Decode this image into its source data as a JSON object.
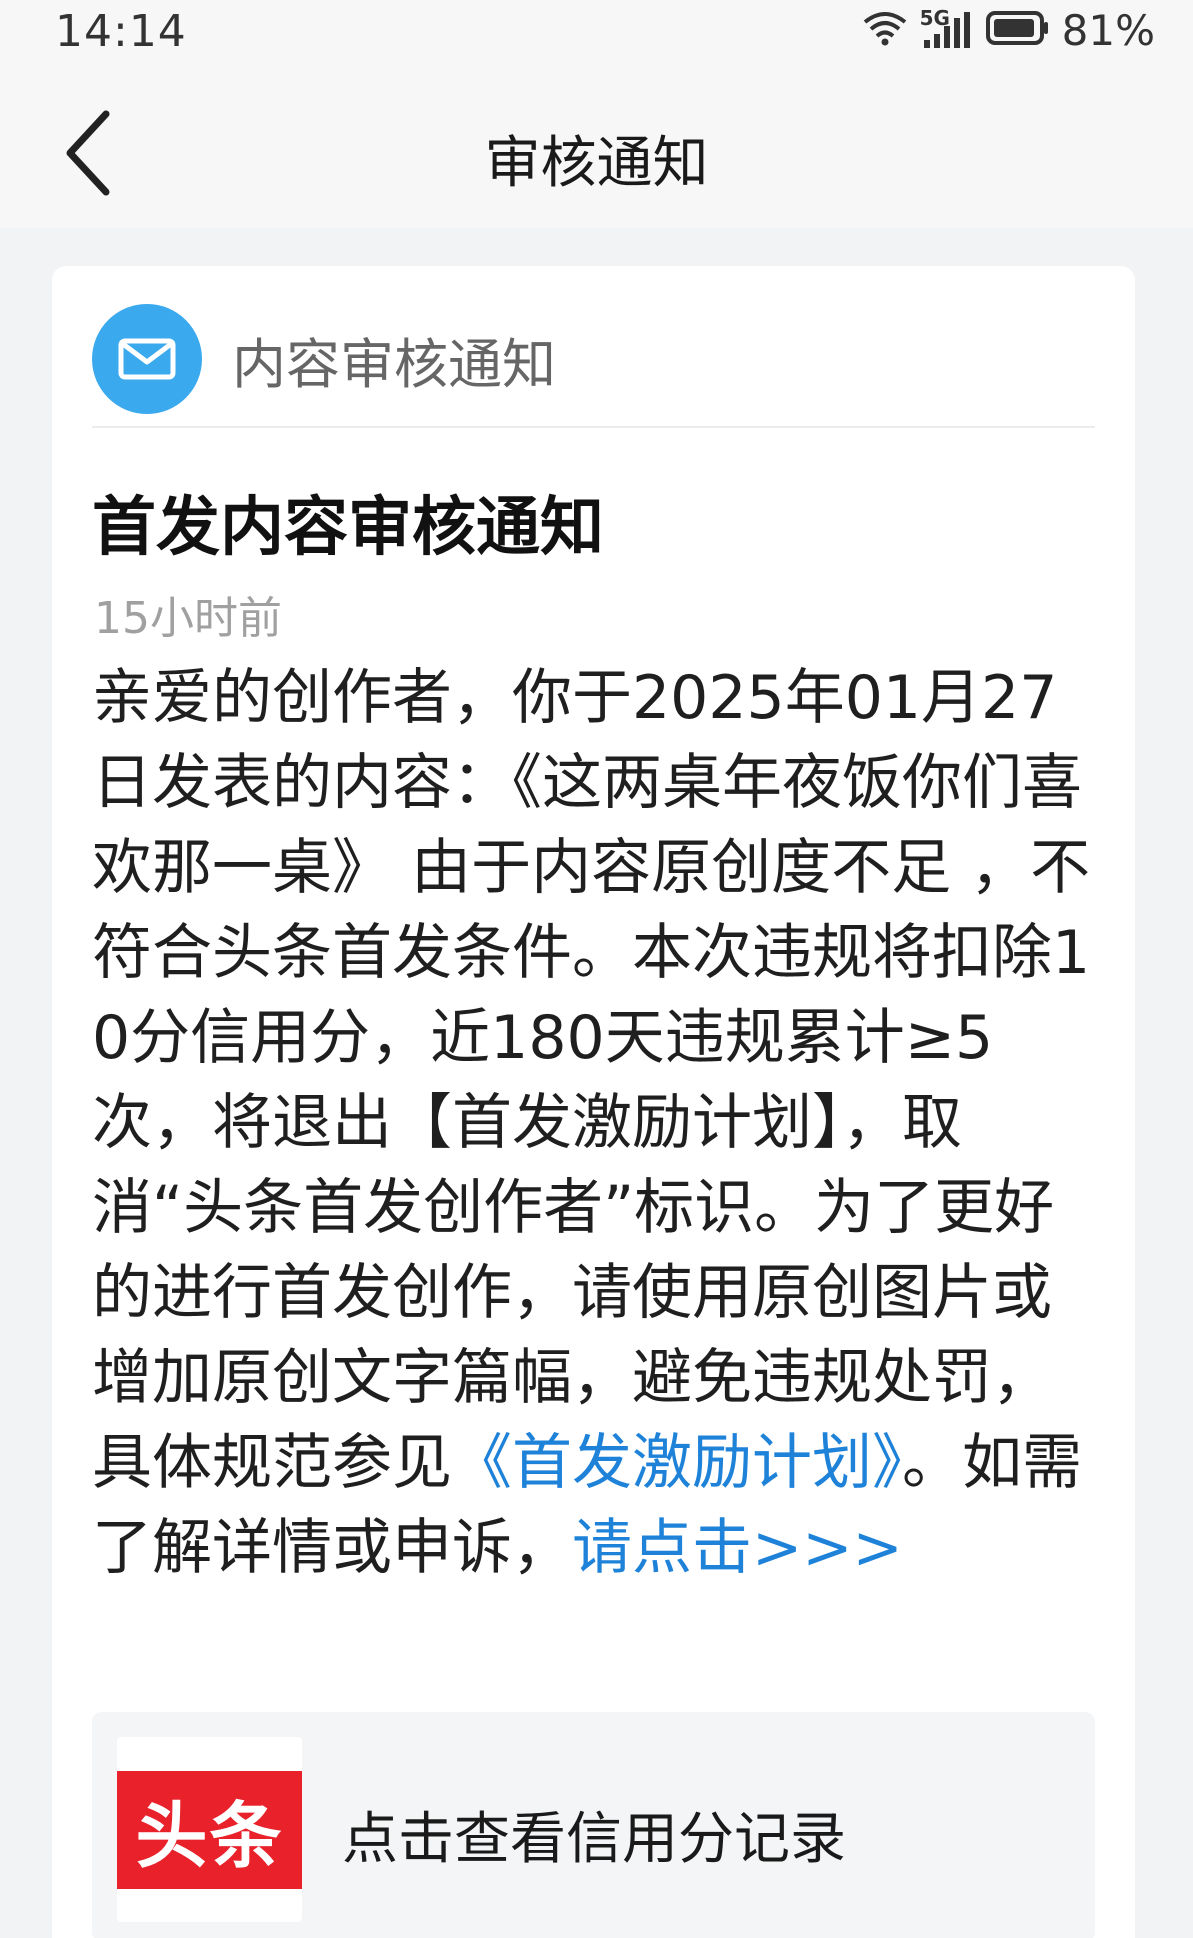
{
  "status_bar": {
    "time": "14:14",
    "network": "5G",
    "battery": "81%"
  },
  "nav": {
    "title": "审核通知",
    "back_icon": "chevron-left-icon"
  },
  "card": {
    "category_icon": "mail-icon",
    "category_title": "内容审核通知",
    "title": "首发内容审核通知",
    "time": "15小时前",
    "body_part1": "亲爱的创作者，你于2025年01月27日发表的内容：《这两桌年夜饭你们喜欢那一桌》 由于内容原创度不足 ，不符合头条首发条件。本次违规将扣除10分信用分，近180天违规累计≥5次，将退出【首发激励计划】，取消“头条首发创作者”标识。为了更好的进行首发创作，请使用原创图片或增加原创文字篇幅，避免违规处罚，具体规范参见",
    "plan_link": "《首发激励计划》",
    "body_part2": "。如需了解详情或申诉，",
    "appeal_link": "请点击>>>",
    "footer": {
      "logo_text": "头条",
      "label": "点击查看信用分记录"
    }
  },
  "colors": {
    "link": "#1e82d9",
    "mail_icon_bg": "#3ba9ee",
    "logo_red": "#e8212b"
  }
}
